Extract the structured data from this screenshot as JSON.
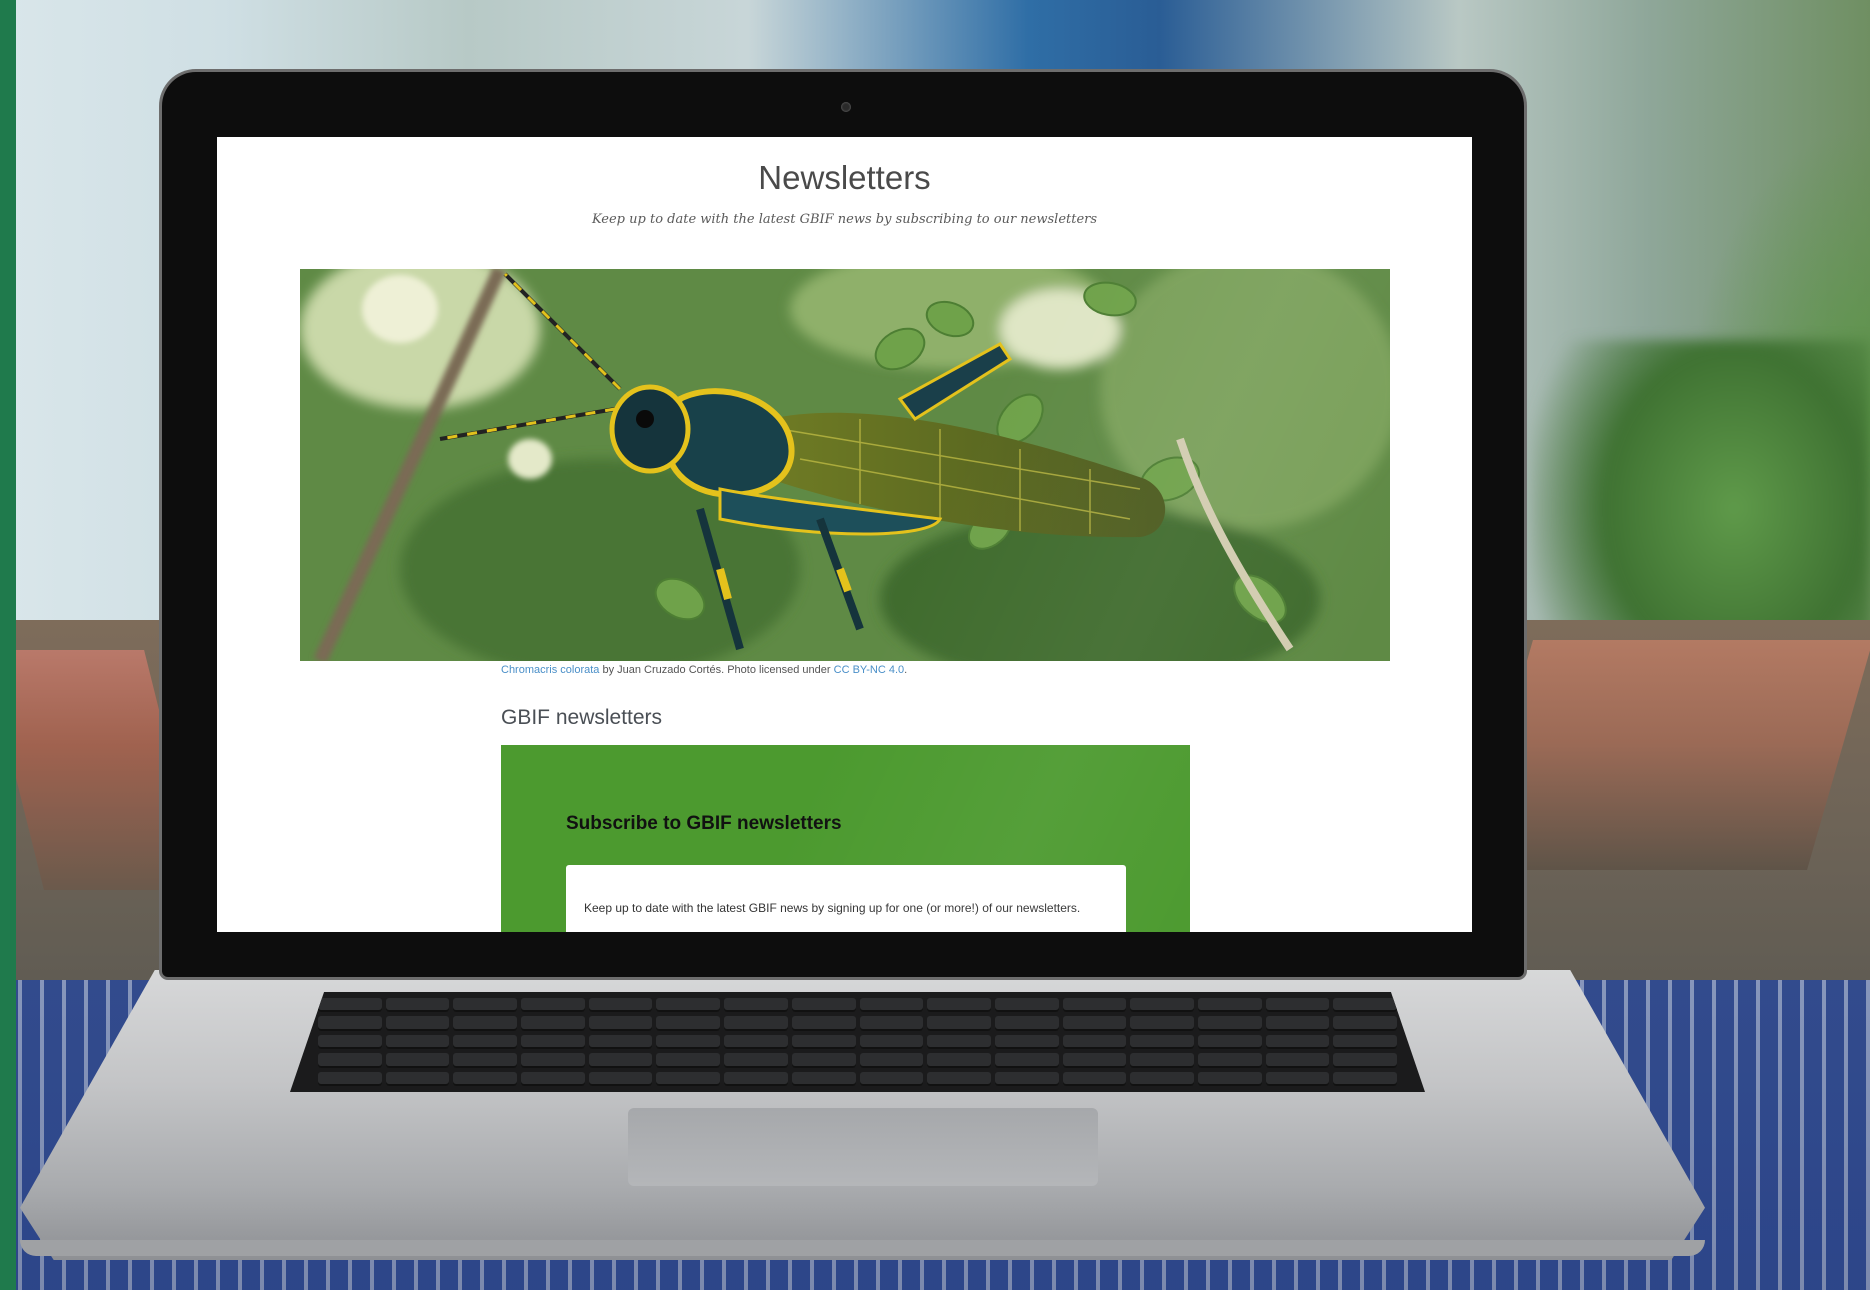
{
  "page": {
    "title": "Newsletters",
    "subtitle": "Keep up to date with the latest GBIF news by subscribing to our newsletters"
  },
  "hero": {
    "image_subject": "grasshopper-on-foliage",
    "caption": {
      "species": "Chromacris colorata",
      "credit_text": " by Juan Cruzado Cortés. Photo licensed under ",
      "license": "CC BY-NC 4.0",
      "end": "."
    }
  },
  "section": {
    "heading": "GBIF newsletters"
  },
  "subscribe": {
    "title": "Subscribe to GBIF newsletters",
    "body": "Keep up to date with the latest GBIF news by signing up for one (or more!) of our newsletters.",
    "background_color": "#4c9a2f"
  },
  "colors": {
    "link": "#4a8fc8",
    "brand_green": "#4c9a2f"
  }
}
